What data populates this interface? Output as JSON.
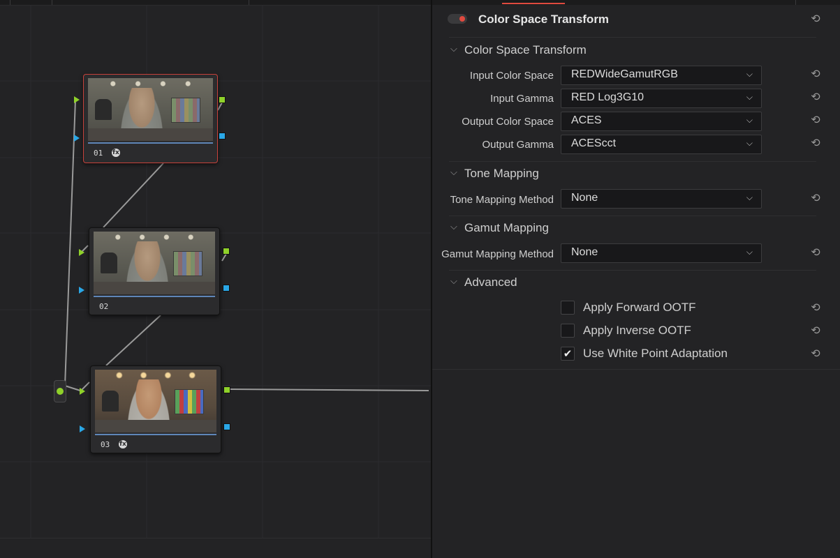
{
  "nodes": [
    {
      "id": "01",
      "label": "01",
      "has_fx": true,
      "selected": true
    },
    {
      "id": "02",
      "label": "02",
      "has_fx": false,
      "selected": false
    },
    {
      "id": "03",
      "label": "03",
      "has_fx": true,
      "selected": false
    }
  ],
  "panel": {
    "title": "Color Space Transform",
    "enabled": true,
    "sections": {
      "cst": {
        "header": "Color Space Transform",
        "fields": [
          {
            "label": "Input Color Space",
            "value": "REDWideGamutRGB"
          },
          {
            "label": "Input Gamma",
            "value": "RED Log3G10"
          },
          {
            "label": "Output Color Space",
            "value": "ACES"
          },
          {
            "label": "Output Gamma",
            "value": "ACEScct"
          }
        ]
      },
      "tone": {
        "header": "Tone Mapping",
        "fields": [
          {
            "label": "Tone Mapping Method",
            "value": "None"
          }
        ]
      },
      "gamut": {
        "header": "Gamut Mapping",
        "fields": [
          {
            "label": "Gamut Mapping Method",
            "value": "None"
          }
        ]
      },
      "advanced": {
        "header": "Advanced",
        "checkboxes": [
          {
            "label": "Apply Forward OOTF",
            "checked": false
          },
          {
            "label": "Apply Inverse OOTF",
            "checked": false
          },
          {
            "label": "Use White Point Adaptation",
            "checked": true
          }
        ]
      }
    }
  },
  "icons": {
    "reset": "reset-icon",
    "dropdown": "chevron-down-icon",
    "section": "chevron-down-icon",
    "fx": "fx-badge-icon",
    "check": "checkmark-icon"
  },
  "colors": {
    "accent_red": "#e04a3f",
    "port_green": "#8fd12a",
    "port_blue": "#2aa7e6",
    "node_bar": "#5f86b8"
  },
  "glyphs": {
    "chevron": "⌵",
    "reset": "⟲",
    "check": "✔",
    "fx": "fx"
  }
}
